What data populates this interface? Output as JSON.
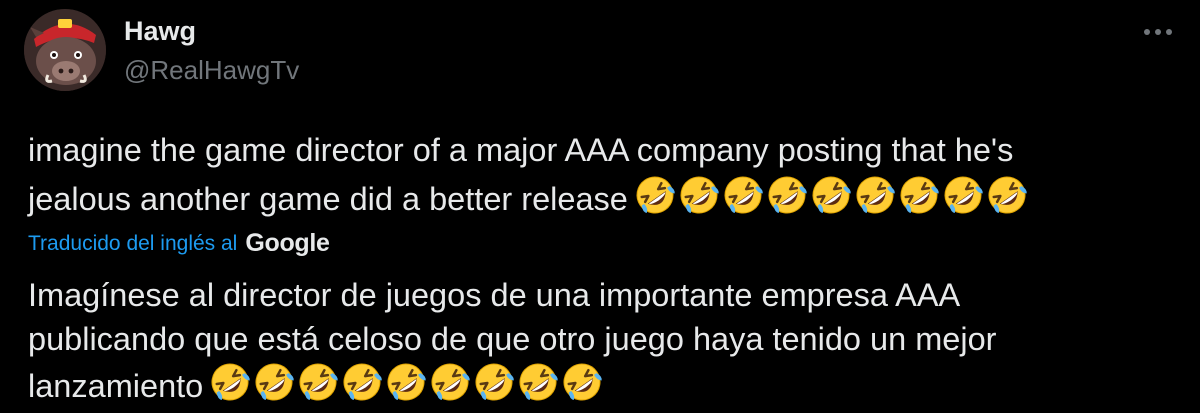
{
  "tweet": {
    "author_name": "Hawg",
    "author_handle": "@RealHawgTv",
    "text_line_1": "imagine the game director of a major AAA company posting that he's",
    "text_line_2": "jealous another game did a better release",
    "emoji_name": "rolling-on-floor-laughing-icon",
    "emoji_count_original": 9,
    "translation": {
      "label": "Traducido del inglés al",
      "provider": "Google",
      "line_1": "Imagínese al director de juegos de una importante empresa AAA",
      "line_2": "publicando que está celoso de que otro juego haya tenido un mejor",
      "line_3": "lanzamiento",
      "emoji_count": 9
    }
  },
  "colors": {
    "background": "#000000",
    "text_primary": "#e7e9ea",
    "text_secondary": "#71767b",
    "link": "#1d9bf0"
  }
}
